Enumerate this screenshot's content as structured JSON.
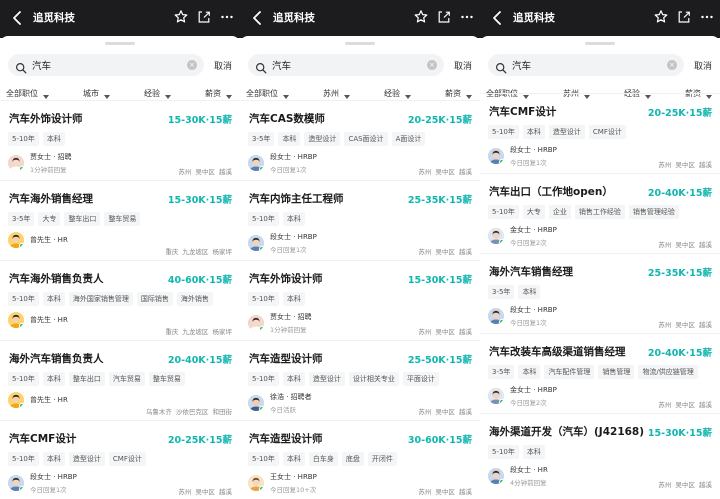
{
  "panels": [
    {
      "title": "追觅科技",
      "search_query": "汽车",
      "cancel_label": "取消",
      "filters": [
        "全部职位",
        "城市",
        "经验",
        "薪资"
      ],
      "jobs": [
        {
          "title": "汽车外饰设计师",
          "salary": "15-30K·15薪",
          "tags": [
            "5-10年",
            "本科"
          ],
          "recruiter": "贾女士 · 招聘",
          "status": "1分钟前回复",
          "location": "苏州 吴中区 越溪",
          "avatar": "female"
        },
        {
          "title": "汽车海外销售经理",
          "salary": "15-30K·15薪",
          "tags": [
            "3-5年",
            "大专",
            "整车出口",
            "整车贸易"
          ],
          "recruiter": "曾先生 · HR",
          "status": "",
          "location": "重庆 九龙坡区 杨家坪",
          "avatar": "male"
        },
        {
          "title": "汽车海外销售负责人",
          "salary": "40-60K·15薪",
          "tags": [
            "5-10年",
            "本科",
            "海外国家销售管理",
            "国际销售",
            "海外销售"
          ],
          "recruiter": "曾先生 · HR",
          "status": "",
          "location": "重庆 九龙坡区 杨家坪",
          "avatar": "male"
        },
        {
          "title": "海外汽车销售负责人",
          "salary": "20-40K·15薪",
          "tags": [
            "5-10年",
            "本科",
            "整车出口",
            "汽车贸易",
            "整车贸易"
          ],
          "recruiter": "曾先生 · HR",
          "status": "",
          "location": "乌鲁木齐 沙依巴克区 和田街",
          "avatar": "male"
        },
        {
          "title": "汽车CMF设计",
          "salary": "20-25K·15薪",
          "tags": [
            "5-10年",
            "本科",
            "造型设计",
            "CMF设计"
          ],
          "recruiter": "段女士 · HRBP",
          "status": "今日回复1次",
          "location": "苏州 吴中区 越溪",
          "avatar": "female2"
        }
      ]
    },
    {
      "title": "追觅科技",
      "search_query": "汽车",
      "cancel_label": "取消",
      "filters": [
        "全部职位",
        "苏州",
        "经验",
        "薪资"
      ],
      "jobs": [
        {
          "title": "汽车CAS数模师",
          "salary": "20-25K·15薪",
          "tags": [
            "3-5年",
            "本科",
            "造型设计",
            "CAS面设计",
            "A面设计"
          ],
          "recruiter": "段女士 · HRBP",
          "status": "今日回复1次",
          "location": "苏州 吴中区 越溪",
          "avatar": "female2"
        },
        {
          "title": "汽车内饰主任工程师",
          "salary": "25-35K·15薪",
          "tags": [
            "5-10年",
            "本科"
          ],
          "recruiter": "段女士 · HRBP",
          "status": "今日回复1次",
          "location": "苏州 吴中区 越溪",
          "avatar": "female2"
        },
        {
          "title": "汽车外饰设计师",
          "salary": "15-30K·15薪",
          "tags": [
            "5-10年",
            "本科"
          ],
          "recruiter": "贾女士 · 招聘",
          "status": "1分钟前回复",
          "location": "苏州 吴中区 越溪",
          "avatar": "female"
        },
        {
          "title": "汽车造型设计师",
          "salary": "25-50K·15薪",
          "tags": [
            "5-10年",
            "本科",
            "造型设计",
            "设计相关专业",
            "平面设计"
          ],
          "recruiter": "徐浩 · 招聘者",
          "status": "今日活跃",
          "location": "苏州 吴中区 越溪",
          "avatar": "male2"
        },
        {
          "title": "汽车造型设计师",
          "salary": "30-60K·15薪",
          "tags": [
            "5-10年",
            "本科",
            "白车身",
            "底盘",
            "开闭件"
          ],
          "recruiter": "王女士 · HRBP",
          "status": "今日回复10+次",
          "location": "苏州 吴中区 越溪",
          "avatar": "female3"
        }
      ]
    },
    {
      "title": "追觅科技",
      "search_query": "汽车",
      "cancel_label": "取消",
      "filters": [
        "全部职位",
        "苏州",
        "经验",
        "薪资"
      ],
      "jobs": [
        {
          "title": "汽车CMF设计",
          "salary": "20-25K·15薪",
          "tags": [
            "5-10年",
            "本科",
            "造型设计",
            "CMF设计"
          ],
          "recruiter": "段女士 · HRBP",
          "status": "今日回复1次",
          "location": "苏州 吴中区 越溪",
          "avatar": "female2"
        },
        {
          "title": "汽车出口（工作地open）",
          "salary": "20-40K·15薪",
          "tags": [
            "5-10年",
            "大专",
            "企业",
            "销售工作经验",
            "销售管理经验"
          ],
          "recruiter": "金女士 · HRBP",
          "status": "今日回复2次",
          "location": "苏州 吴中区 越溪",
          "avatar": "female4"
        },
        {
          "title": "海外汽车销售经理",
          "salary": "25-35K·15薪",
          "tags": [
            "3-5年",
            "本科"
          ],
          "recruiter": "段女士 · HRBP",
          "status": "今日回复1次",
          "location": "苏州 吴中区 越溪",
          "avatar": "female2"
        },
        {
          "title": "汽车改装车高级渠道销售经理",
          "salary": "20-40K·15薪",
          "tags": [
            "3-5年",
            "本科",
            "汽车配件管理",
            "销售管理",
            "物流/供应链管理"
          ],
          "recruiter": "金女士 · HRBP",
          "status": "今日回复2次",
          "location": "苏州 吴中区 越溪",
          "avatar": "female4"
        },
        {
          "title": "海外渠道开发（汽车）(J42168)",
          "salary": "15-30K·15薪",
          "tags": [
            "5-10年",
            "本科"
          ],
          "recruiter": "段女士 · HR",
          "status": "4分钟前回复",
          "location": "苏州 吴中区 越溪",
          "avatar": "female2"
        }
      ]
    }
  ],
  "colors": {
    "salary": "#11b6b0",
    "online_dot": "#20c05c",
    "topbar": "#1c1c1e"
  },
  "icons": [
    "back-icon",
    "star-icon",
    "share-icon",
    "more-icon",
    "search-icon",
    "clear-icon",
    "chevron-down-icon"
  ]
}
